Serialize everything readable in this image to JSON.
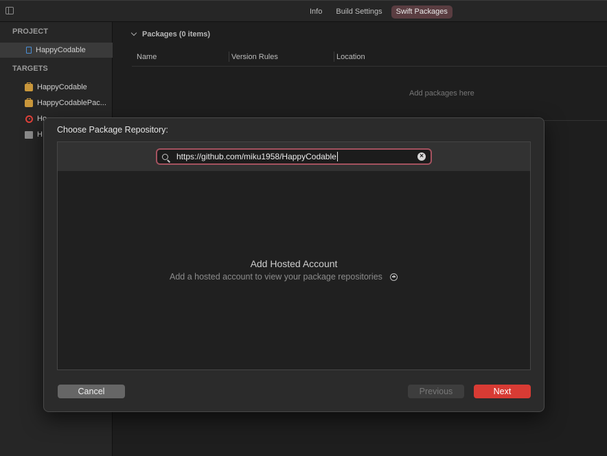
{
  "window": {
    "tabs": [
      {
        "label": "Info",
        "active": false
      },
      {
        "label": "Build Settings",
        "active": false
      },
      {
        "label": "Swift Packages",
        "active": true
      }
    ]
  },
  "sidebar": {
    "project_header": "PROJECT",
    "project_item": "HappyCodable",
    "targets_header": "TARGETS",
    "targets": [
      {
        "label": "HappyCodable",
        "icon": "briefcase-icon"
      },
      {
        "label": "HappyCodablePac...",
        "icon": "briefcase-icon"
      },
      {
        "label": "Ho",
        "icon": "target-icon"
      },
      {
        "label": "H",
        "icon": "framework-box-icon"
      }
    ]
  },
  "packages": {
    "header": "Packages (0 items)",
    "columns": [
      "Name",
      "Version Rules",
      "Location"
    ],
    "empty_text": "Add packages here"
  },
  "dialog": {
    "title": "Choose Package Repository:",
    "search_value": "https://github.com/miku1958/HappyCodable",
    "empty_title": "Add Hosted Account",
    "empty_subtitle": "Add a hosted account to view your package repositories",
    "cancel_label": "Cancel",
    "previous_label": "Previous",
    "next_label": "Next"
  },
  "colors": {
    "accent_red": "#d83b34",
    "focus_ring": "#a4525f",
    "active_tab": "#5a3d41"
  }
}
